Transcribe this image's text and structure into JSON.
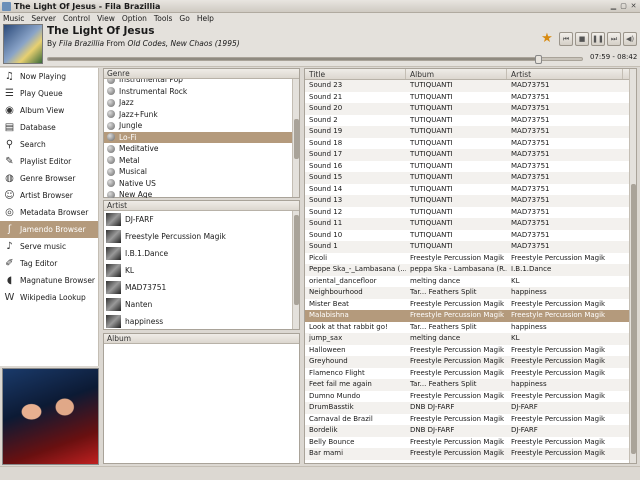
{
  "window": {
    "title": "The Light Of Jesus - Fila Brazillia"
  },
  "menu": [
    "Music",
    "Server",
    "Control",
    "View",
    "Option",
    "Tools",
    "Go",
    "Help"
  ],
  "now_playing": {
    "title": "The Light Of Jesus",
    "by_label": "By",
    "artist": "Fila Brazillia",
    "from_label": "From",
    "album": "Old Codes, New Chaos (1995)",
    "time": "07:59 - 08:42",
    "progress_fraction": 0.919
  },
  "sidebar": {
    "items": [
      {
        "label": "Now Playing",
        "icon": "music-note-icon"
      },
      {
        "label": "Play Queue",
        "icon": "queue-icon"
      },
      {
        "label": "Album View",
        "icon": "eye-icon"
      },
      {
        "label": "Database",
        "icon": "database-icon"
      },
      {
        "label": "Search",
        "icon": "search-icon"
      },
      {
        "label": "Playlist Editor",
        "icon": "playlist-icon"
      },
      {
        "label": "Genre Browser",
        "icon": "genre-icon"
      },
      {
        "label": "Artist Browser",
        "icon": "artist-icon"
      },
      {
        "label": "Metadata Browser",
        "icon": "metadata-icon"
      },
      {
        "label": "Jamendo Browser",
        "icon": "jamendo-icon"
      },
      {
        "label": "Serve music",
        "icon": "serve-icon"
      },
      {
        "label": "Tag Editor",
        "icon": "tag-icon"
      },
      {
        "label": "Magnatune Browser",
        "icon": "magnatune-icon"
      },
      {
        "label": "Wikipedia Lookup",
        "icon": "wikipedia-icon"
      }
    ],
    "active_index": 9
  },
  "genre_panel": {
    "header": "Genre",
    "items": [
      "Instrumental Pop",
      "Instrumental Rock",
      "Jazz",
      "Jazz+Funk",
      "Jungle",
      "Lo-Fi",
      "Meditative",
      "Metal",
      "Musical",
      "Native US",
      "New Age"
    ],
    "selected_index": 5
  },
  "artist_panel": {
    "header": "Artist",
    "items": [
      "DJ-FARF",
      "Freestyle Percussion Magik",
      "I.B.1.Dance",
      "KL",
      "MAD73751",
      "Nanten",
      "happiness"
    ]
  },
  "album_panel": {
    "header": "Album"
  },
  "tracks": {
    "headers": [
      "Title",
      "Album",
      "Artist"
    ],
    "rows": [
      [
        "Sound 23",
        "TUTIQUANTI",
        "MAD73751"
      ],
      [
        "Sound 21",
        "TUTIQUANTI",
        "MAD73751"
      ],
      [
        "Sound 20",
        "TUTIQUANTI",
        "MAD73751"
      ],
      [
        "Sound 2",
        "TUTIQUANTI",
        "MAD73751"
      ],
      [
        "Sound 19",
        "TUTIQUANTI",
        "MAD73751"
      ],
      [
        "Sound 18",
        "TUTIQUANTI",
        "MAD73751"
      ],
      [
        "Sound 17",
        "TUTIQUANTI",
        "MAD73751"
      ],
      [
        "Sound 16",
        "TUTIQUANTI",
        "MAD73751"
      ],
      [
        "Sound 15",
        "TUTIQUANTI",
        "MAD73751"
      ],
      [
        "Sound 14",
        "TUTIQUANTI",
        "MAD73751"
      ],
      [
        "Sound 13",
        "TUTIQUANTI",
        "MAD73751"
      ],
      [
        "Sound 12",
        "TUTIQUANTI",
        "MAD73751"
      ],
      [
        "Sound 11",
        "TUTIQUANTI",
        "MAD73751"
      ],
      [
        "Sound 10",
        "TUTIQUANTI",
        "MAD73751"
      ],
      [
        "Sound 1",
        "TUTIQUANTI",
        "MAD73751"
      ],
      [
        "Picoli",
        "Freestyle Percussion Magik",
        "Freestyle Percussion Magik"
      ],
      [
        "Peppe Ska_-_Lambasana (...",
        "peppa Ska - Lambasana (R...",
        "I.B.1.Dance"
      ],
      [
        "oriental_dancefloor",
        "melting dance",
        "KL"
      ],
      [
        "Neighbourhood",
        "Tar... Feathers Split",
        "happiness"
      ],
      [
        "Mister Beat",
        "Freestyle Percussion Magik",
        "Freestyle Percussion Magik"
      ],
      [
        "Malabishna",
        "Freestyle Percussion Magik",
        "Freestyle Percussion Magik"
      ],
      [
        "Look at that rabbit go!",
        "Tar... Feathers Split",
        "happiness"
      ],
      [
        "jump_sax",
        "melting dance",
        "KL"
      ],
      [
        "Halloween",
        "Freestyle Percussion Magik",
        "Freestyle Percussion Magik"
      ],
      [
        "Greyhound",
        "Freestyle Percussion Magik",
        "Freestyle Percussion Magik"
      ],
      [
        "Flamenco Flight",
        "Freestyle Percussion Magik",
        "Freestyle Percussion Magik"
      ],
      [
        "Feet fail me again",
        "Tar... Feathers Split",
        "happiness"
      ],
      [
        "Dumno Mundo",
        "Freestyle Percussion Magik",
        "Freestyle Percussion Magik"
      ],
      [
        "DrumBasstik",
        "DNB DJ-FARF",
        "DJ-FARF"
      ],
      [
        "Carnaval de Brazil",
        "Freestyle Percussion Magik",
        "Freestyle Percussion Magik"
      ],
      [
        "Bordelik",
        "DNB DJ-FARF",
        "DJ-FARF"
      ],
      [
        "Belly Bounce",
        "Freestyle Percussion Magik",
        "Freestyle Percussion Magik"
      ],
      [
        "Bar mami",
        "Freestyle Percussion Magik",
        "Freestyle Percussion Magik"
      ]
    ],
    "selected_index": 20
  }
}
